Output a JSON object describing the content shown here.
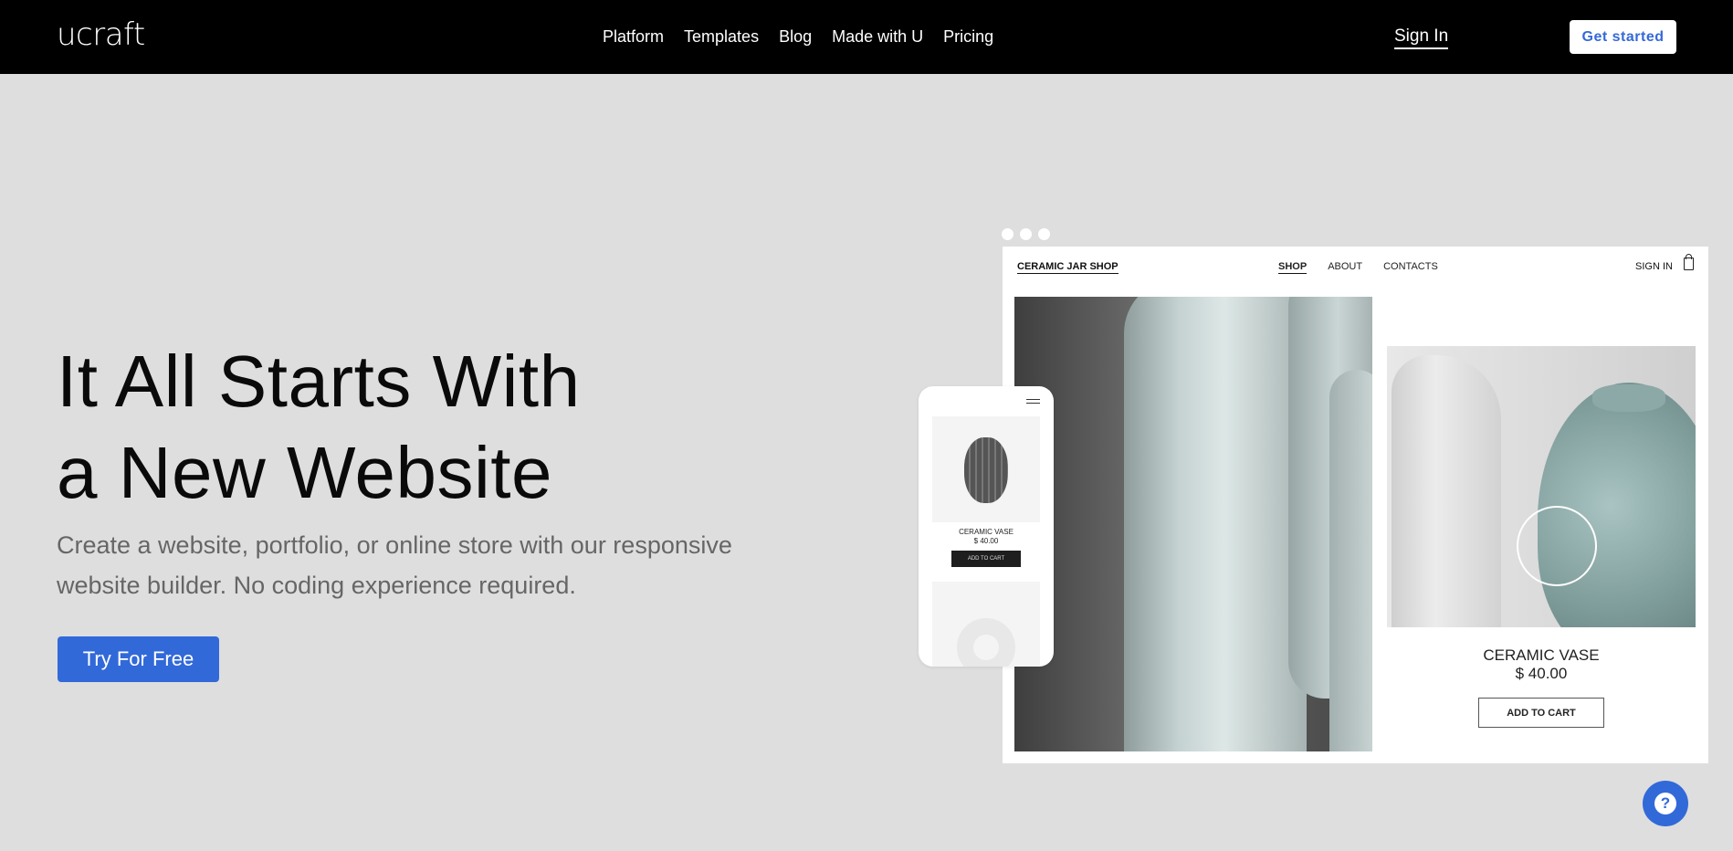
{
  "header": {
    "logo": "ucraft",
    "nav": [
      "Platform",
      "Templates",
      "Blog",
      "Made with U",
      "Pricing"
    ],
    "sign_in": "Sign In",
    "get_started": "Get started"
  },
  "hero": {
    "title_line1": "It All Starts With",
    "title_line2": "a New Website",
    "subtitle": "Create a website, portfolio, or online store with our responsive website builder. No coding experience required.",
    "cta": "Try For Free"
  },
  "preview": {
    "shop_name": "CERAMIC JAR SHOP",
    "nav": [
      "SHOP",
      "ABOUT",
      "CONTACTS"
    ],
    "active_nav": "SHOP",
    "sign_in": "SIGN IN",
    "product": {
      "name": "CERAMIC VASE",
      "price": "$ 40.00",
      "add_to_cart": "ADD TO CART"
    },
    "mobile_product": {
      "name": "CERAMIC VASE",
      "price": "$ 40.00",
      "add_to_cart": "ADD TO CART"
    }
  },
  "help": {
    "icon": "question-icon",
    "label": "?"
  },
  "colors": {
    "accent": "#3269d9",
    "topbar": "#000000",
    "background": "#dedede"
  }
}
